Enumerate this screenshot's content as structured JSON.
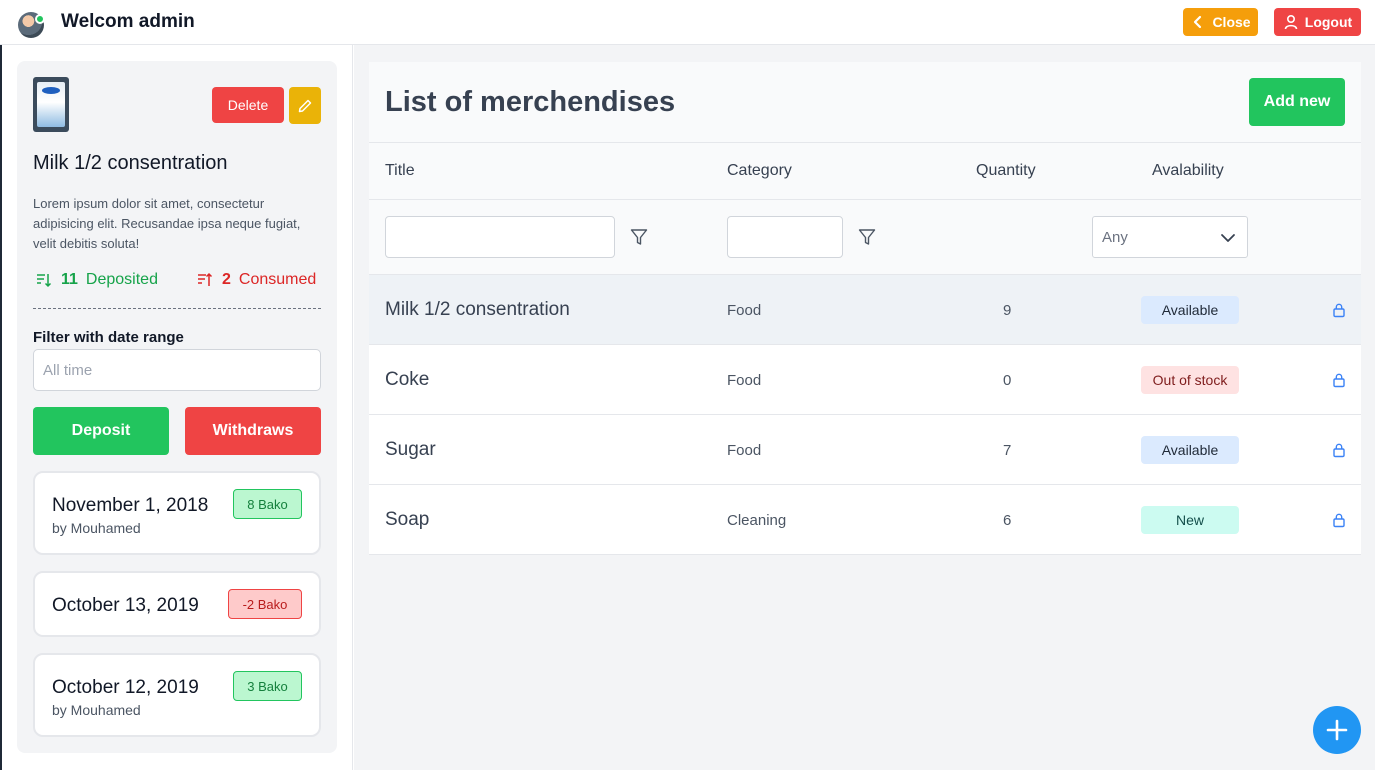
{
  "header": {
    "welcome_text": "Welcom admin",
    "close_label": "Close",
    "logout_label": "Logout"
  },
  "product": {
    "delete_label": "Delete",
    "title": "Milk 1/2 consentration",
    "description": "Lorem ipsum dolor sit amet, consectetur adipisicing elit. Recusandae ipsa neque fugiat, velit debitis soluta!",
    "deposited_count": "11",
    "deposited_label": "Deposited",
    "consumed_count": "2",
    "consumed_label": "Consumed",
    "filter_label": "Filter with date range",
    "date_placeholder": "All time",
    "deposit_label": "Deposit",
    "withdraws_label": "Withdraws",
    "transactions": [
      {
        "date": "November 1, 2018",
        "by": "by Mouhamed",
        "amount": "8 Bako",
        "type": "positive"
      },
      {
        "date": "October 13, 2019",
        "by": "",
        "amount": "-2 Bako",
        "type": "negative"
      },
      {
        "date": "October 12, 2019",
        "by": "by Mouhamed",
        "amount": "3 Bako",
        "type": "positive"
      }
    ]
  },
  "list": {
    "title": "List of merchendises",
    "add_label": "Add new",
    "columns": {
      "title": "Title",
      "category": "Category",
      "quantity": "Quantity",
      "availability": "Avalability"
    },
    "availability_filter": "Any",
    "rows": [
      {
        "title": "Milk 1/2 consentration",
        "category": "Food",
        "quantity": "9",
        "status": "Available",
        "selected": true
      },
      {
        "title": "Coke",
        "category": "Food",
        "quantity": "0",
        "status": "Out of stock",
        "selected": false
      },
      {
        "title": "Sugar",
        "category": "Food",
        "quantity": "7",
        "status": "Available",
        "selected": false
      },
      {
        "title": "Soap",
        "category": "Cleaning",
        "quantity": "6",
        "status": "New",
        "selected": false
      }
    ]
  },
  "colors": {
    "green": "#22c55e",
    "red": "#ef4444",
    "amber": "#f59e0b",
    "yellow": "#eab308",
    "blue": "#2196f3"
  },
  "icons": {
    "close": "chevron-left-icon",
    "logout": "user-icon",
    "edit": "pencil-icon",
    "deposited": "sort-down-icon",
    "consumed": "sort-up-icon",
    "filter": "funnel-icon",
    "select": "chevron-down-icon",
    "row_action": "lock-icon",
    "fab": "plus-icon"
  }
}
